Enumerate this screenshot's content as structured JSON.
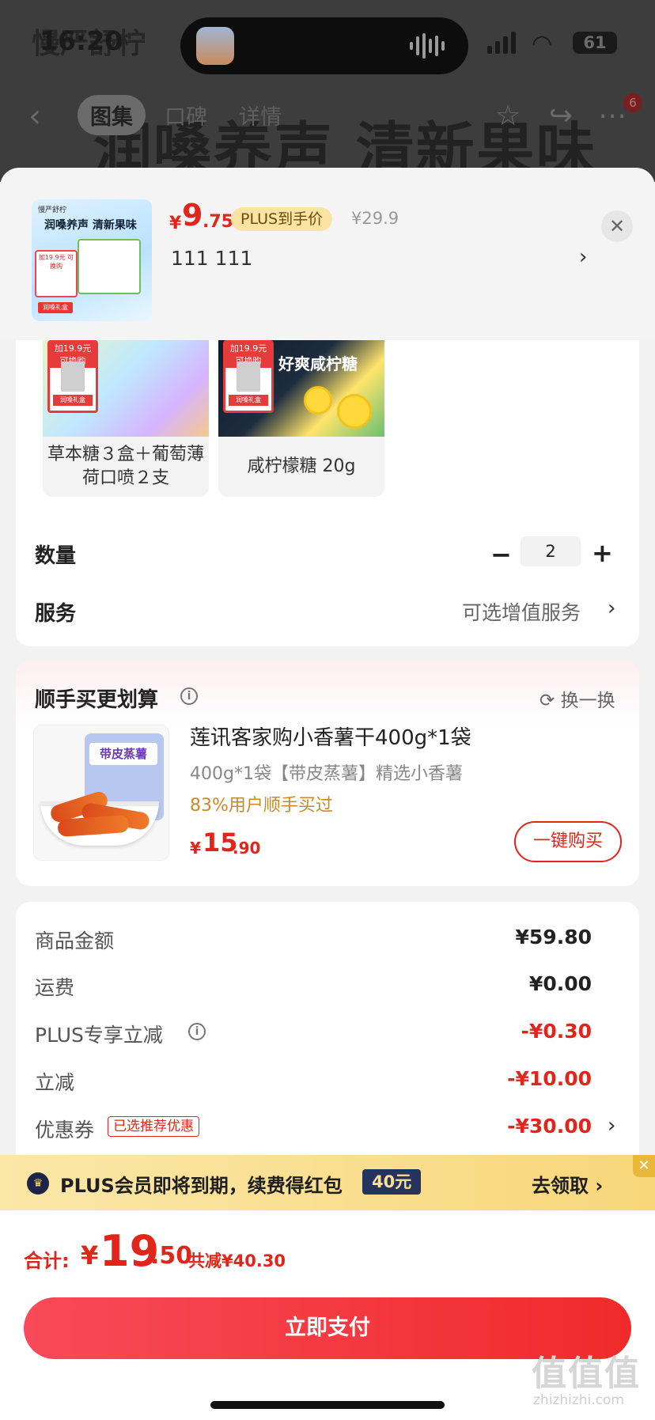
{
  "status_bar": {
    "time": "16:20",
    "battery": "61"
  },
  "background": {
    "headline": "润嗓养声 清新果味",
    "brand": "慢严舒柠"
  },
  "nav": {
    "tabs": [
      "图集",
      "口碑",
      "详情"
    ],
    "badge": "6"
  },
  "product": {
    "thumb_brand": "慢严舒柠",
    "thumb_headline": "润嗓养声 清新果味",
    "thumb_tag": "加19.9元 可换购",
    "thumb_bottom": "润嗓礼盒",
    "price_symbol": "¥",
    "price_int": "9",
    "price_dec": ".75",
    "plus_badge": "PLUS到手价",
    "original_price": "¥29.9",
    "selected_sku": "111  111"
  },
  "variants": [
    {
      "label": "草本糖３盒＋葡萄薄荷口喷２支",
      "tag_top": "加19.9元 可换购",
      "tag_foot": "润嗓礼盒"
    },
    {
      "label": "咸柠檬糖 20g",
      "tag_top": "加19.9元 可换购",
      "tag_foot": "润嗓礼盒",
      "pack_title": "好爽咸柠糖"
    }
  ],
  "quantity": {
    "label": "数量",
    "value": "2",
    "minus": "−",
    "plus": "+"
  },
  "service": {
    "label": "服务",
    "value": "可选增值服务"
  },
  "recommend": {
    "title": "顺手买更划算",
    "swap_label": "换一换",
    "bag_label": "带皮蒸薯",
    "name": "莲讯客家购小香薯干400g*1袋",
    "spec": "400g*1袋【带皮蒸薯】精选小香薯",
    "percent": "83%用户顺手买过",
    "price_symbol": "¥",
    "price_int": "15",
    "price_dec": ".90",
    "button": "一键购买"
  },
  "summary": {
    "rows": [
      {
        "label": "商品金额",
        "value": "¥59.80"
      },
      {
        "label": "运费",
        "value": "¥0.00"
      },
      {
        "label": "PLUS专享立减",
        "value": "-¥0.30"
      },
      {
        "label": "立减",
        "value": "-¥10.00"
      },
      {
        "label": "优惠券",
        "value": "-¥30.00"
      }
    ],
    "coupon_tag": "已选推荐优惠"
  },
  "plus_banner": {
    "text": "PLUS会员即将到期，续费得红包",
    "chip": "40元",
    "cta": "去领取 ›"
  },
  "total": {
    "label": "合计:",
    "symbol": "¥",
    "int": "19",
    "dec": ".50",
    "saved": "共减¥40.30"
  },
  "pay_button": "立即支付",
  "watermark": {
    "logo": "值值值",
    "site": "zhizhizhi.com"
  },
  "colors": {
    "accent": "#e1251b",
    "plus_gold": "#f8d77a",
    "plus_navy": "#25345e"
  }
}
